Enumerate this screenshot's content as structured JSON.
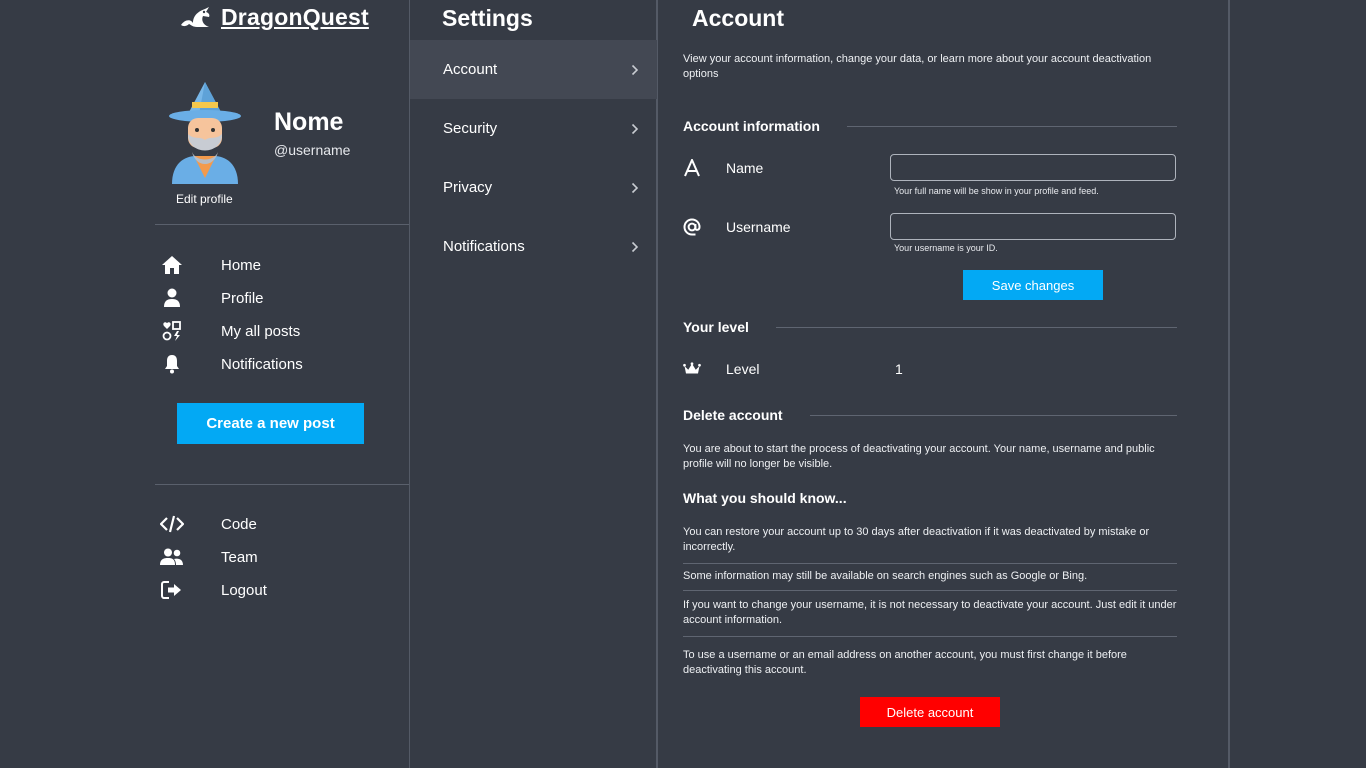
{
  "brand": {
    "name": "DragonQuest",
    "logo_icon": "dragon-logo-icon"
  },
  "profile": {
    "name": "Nome",
    "username": "@username",
    "edit_label": "Edit profile"
  },
  "nav": {
    "items": [
      {
        "label": "Home",
        "icon": "home-icon"
      },
      {
        "label": "Profile",
        "icon": "user-icon"
      },
      {
        "label": "My all posts",
        "icon": "posts-icon"
      },
      {
        "label": "Notifications",
        "icon": "bell-icon"
      }
    ],
    "create_post": "Create a new post",
    "footer_items": [
      {
        "label": "Code",
        "icon": "code-icon"
      },
      {
        "label": "Team",
        "icon": "team-icon"
      },
      {
        "label": "Logout",
        "icon": "logout-icon"
      }
    ]
  },
  "settings": {
    "title": "Settings",
    "items": [
      {
        "label": "Account",
        "active": true
      },
      {
        "label": "Security",
        "active": false
      },
      {
        "label": "Privacy",
        "active": false
      },
      {
        "label": "Notifications",
        "active": false
      }
    ]
  },
  "account": {
    "title": "Account",
    "description": "View your account information, change your data, or learn more about your account deactivation options",
    "info_heading": "Account information",
    "name_label": "Name",
    "name_value": "",
    "name_hint": "Your full name will be show in your profile and feed.",
    "username_label": "Username",
    "username_value": "",
    "username_hint": "Your username is your ID.",
    "save_label": "Save changes",
    "level_heading": "Your level",
    "level_label": "Level",
    "level_value": "1",
    "delete_heading": "Delete account",
    "delete_text": "You are about to start the process of deactivating your account. Your name, username and public profile will no longer be visible.",
    "know_title": "What you should know...",
    "know_items": [
      "You can restore your account up to 30 days after deactivation if it was deactivated by mistake or incorrectly.",
      "Some information may still be available on search engines such as Google or Bing.",
      "If you want to change your username, it is not necessary to deactivate your account. Just edit it under account information.",
      "To use a username or an email address on another account, you must first change it before deactivating this account."
    ],
    "delete_label": "Delete account"
  },
  "colors": {
    "background": "#363b45",
    "accent": "#03a9f4",
    "danger": "#ff0000",
    "active_item": "#434853"
  }
}
